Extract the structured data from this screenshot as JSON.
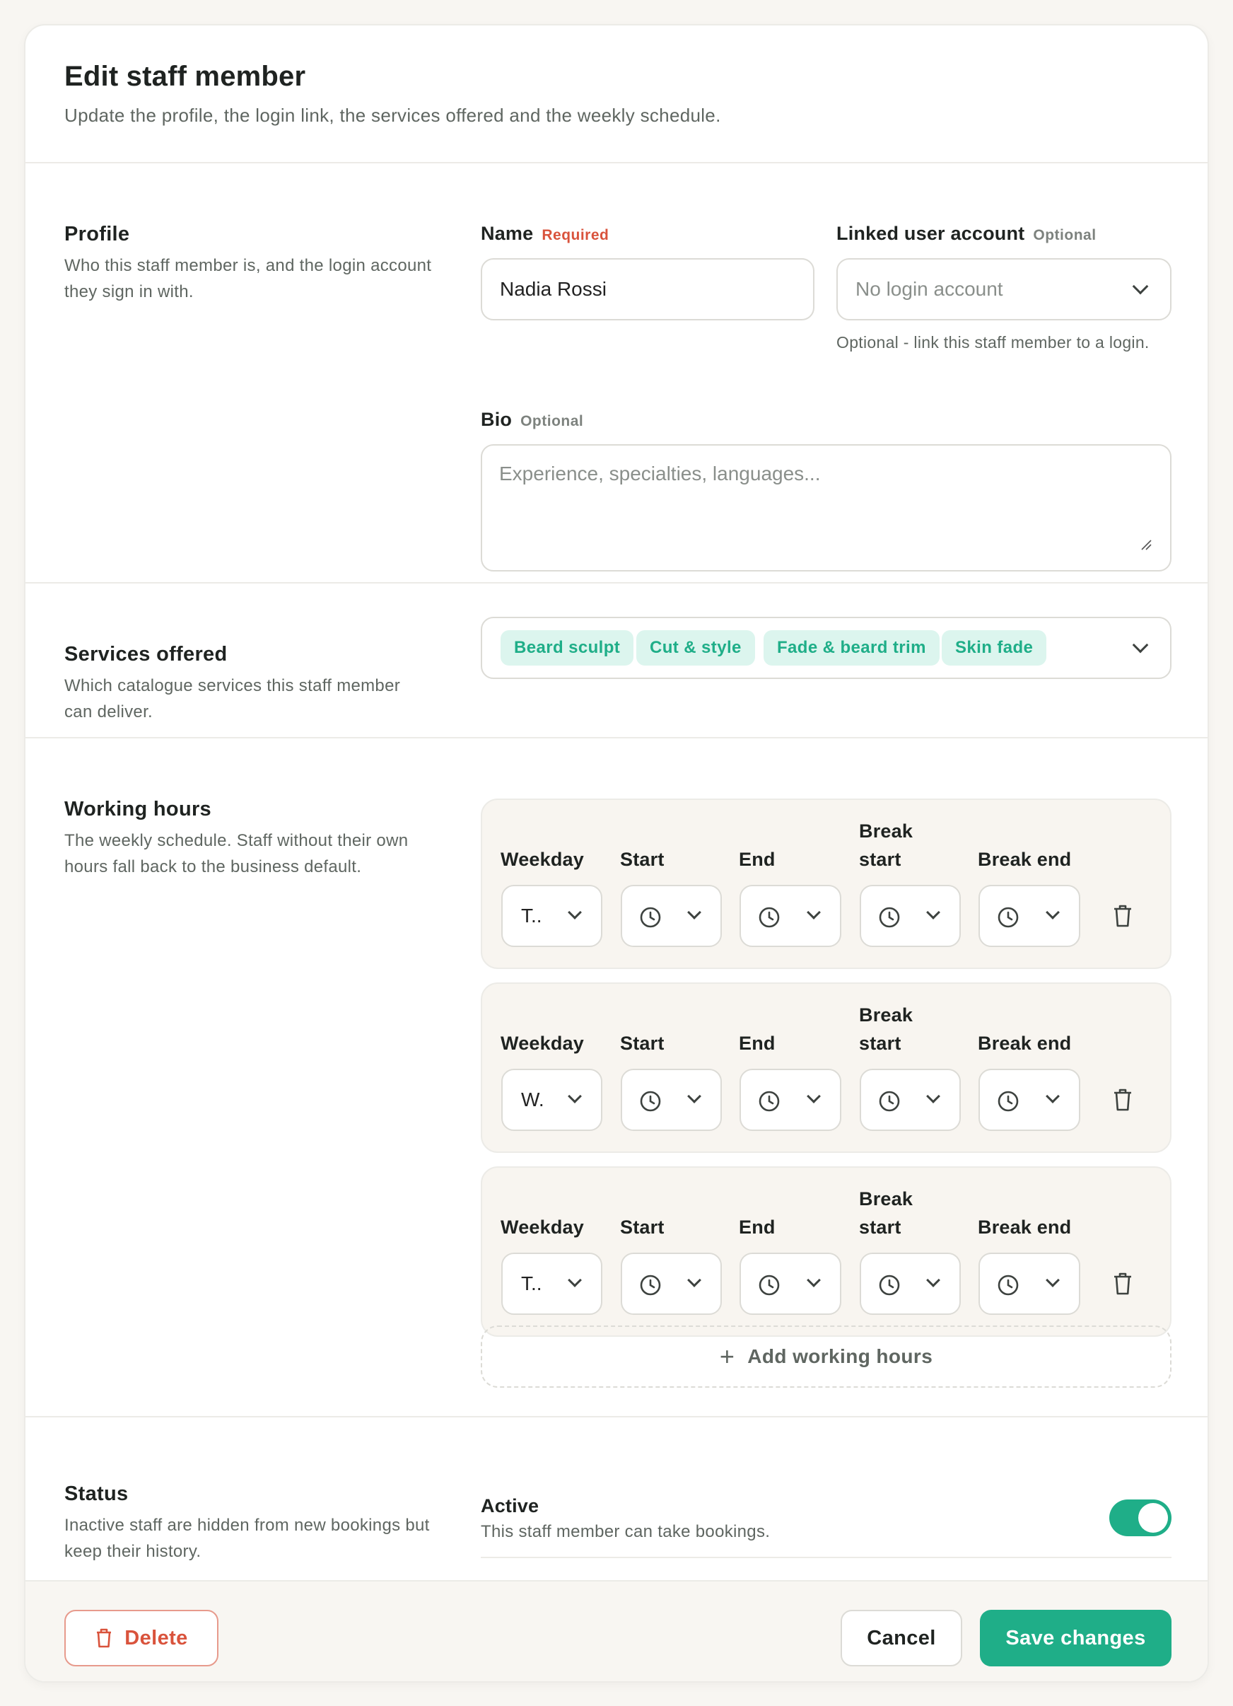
{
  "header": {
    "title": "Edit staff member",
    "subtitle": "Update the profile, the login link, the services offered and the weekly schedule."
  },
  "profile": {
    "title": "Profile",
    "description": "Who this staff member is, and the login account they sign in with.",
    "name_label": "Name",
    "name_tag": "Required",
    "name_value": "Nadia Rossi",
    "account_label": "Linked user account",
    "account_tag": "Optional",
    "account_value": "No login account",
    "account_hint": "Optional - link this staff member to a login.",
    "bio_label": "Bio",
    "bio_tag": "Optional",
    "bio_placeholder": "Experience, specialties, languages..."
  },
  "services": {
    "title": "Services offered",
    "description": "Which catalogue services this staff member can deliver.",
    "chips": [
      "Beard sculpt",
      "Cut & style",
      "Fade & beard trim",
      "Skin fade"
    ]
  },
  "working_hours": {
    "title": "Working hours",
    "description": "The weekly schedule. Staff without their own hours fall back to the business default.",
    "columns": {
      "weekday": "Weekday",
      "start": "Start",
      "end": "End",
      "break_start": "Break start",
      "break_end": "Break end"
    },
    "rows": [
      {
        "weekday": "T.."
      },
      {
        "weekday": "W."
      },
      {
        "weekday": "T.."
      }
    ],
    "add_label": "Add working hours"
  },
  "status": {
    "title": "Status",
    "description": "Inactive staff are hidden from new bookings but keep their history.",
    "active_label": "Active",
    "active_hint": "This staff member can take bookings.",
    "active": true
  },
  "footer": {
    "delete_label": "Delete",
    "cancel_label": "Cancel",
    "save_label": "Save changes"
  },
  "colors": {
    "accent": "#1fae88",
    "danger": "#d9533c",
    "chip_bg": "#dcf5ee"
  }
}
